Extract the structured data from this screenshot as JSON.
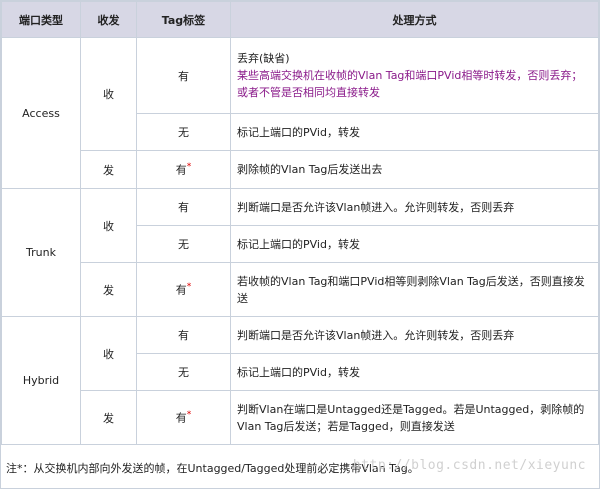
{
  "header": {
    "col_port_type": "端口类型",
    "col_direction": "收发",
    "col_tag": "Tag标签",
    "col_process": "处理方式"
  },
  "rows": {
    "access": {
      "port": "Access",
      "recv": "收",
      "send": "发",
      "recv_tag_label": "有",
      "recv_tag_line1": "丢弃(缺省)",
      "recv_tag_line2": "某些高端交换机在收帧的Vlan Tag和端口PVid相等时转发，否则丢弃；或者不管是否相同均直接转发",
      "recv_notag_label": "无",
      "recv_notag_text": "标记上端口的PVid，转发",
      "send_tag_label": "有",
      "send_tag_mark": "*",
      "send_text": "剥除帧的Vlan Tag后发送出去"
    },
    "trunk": {
      "port": "Trunk",
      "recv": "收",
      "send": "发",
      "recv_tag_label": "有",
      "recv_tag_text": "判断端口是否允许该Vlan帧进入。允许则转发，否则丢弃",
      "recv_notag_label": "无",
      "recv_notag_text": "标记上端口的PVid，转发",
      "send_tag_label": "有",
      "send_tag_mark": "*",
      "send_text": "若收帧的Vlan Tag和端口PVid相等则剥除Vlan Tag后发送，否则直接发送"
    },
    "hybrid": {
      "port": "Hybrid",
      "recv": "收",
      "send": "发",
      "recv_tag_label": "有",
      "recv_tag_text": "判断端口是否允许该Vlan帧进入。允许则转发，否则丢弃",
      "recv_notag_label": "无",
      "recv_notag_text": "标记上端口的PVid，转发",
      "send_tag_label": "有",
      "send_tag_mark": "*",
      "send_text": "判断Vlan在端口是Untagged还是Tagged。若是Untagged，剥除帧的Vlan Tag后发送；若是Tagged，则直接发送"
    }
  },
  "footer": {
    "note": "注*：从交换机内部向外发送的帧，在Untagged/Tagged处理前必定携带Vlan Tag。"
  },
  "watermark": "http://blog.csdn.net/xieyunc",
  "colors": {
    "header_bg": "#d7d7e5",
    "border": "#c9d1dc",
    "highlight_purple": "#8a1a8a",
    "asterisk_red": "#e00000"
  }
}
